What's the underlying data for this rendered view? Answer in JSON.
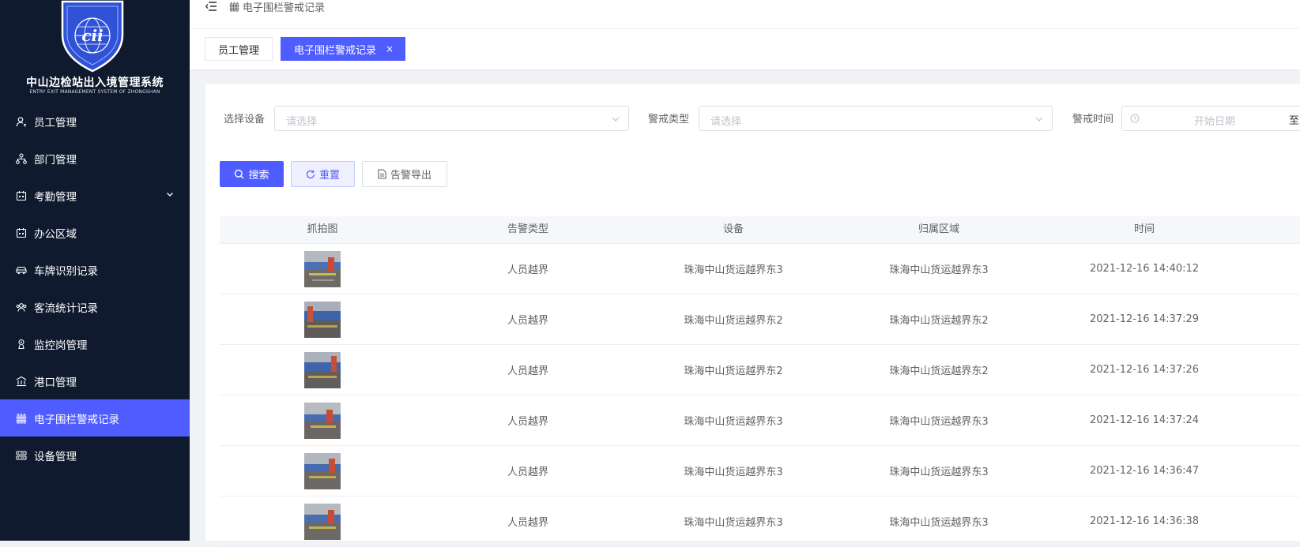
{
  "sidebar": {
    "logo_text": "中国边检",
    "system_title": "中山边检站出入境管理系统",
    "system_subtitle": "ENTRY EXIT MANAGEMENT SYSTEM OF ZHONGSHAN",
    "items": [
      {
        "label": "员工管理",
        "icon": "user-icon"
      },
      {
        "label": "部门管理",
        "icon": "org-chart-icon"
      },
      {
        "label": "考勤管理",
        "icon": "calendar-icon",
        "has_submenu": true
      },
      {
        "label": "办公区域",
        "icon": "calendar-icon"
      },
      {
        "label": "车牌识别记录",
        "icon": "car-icon"
      },
      {
        "label": "客流统计记录",
        "icon": "people-icon"
      },
      {
        "label": "监控岗管理",
        "icon": "monitor-post-icon"
      },
      {
        "label": "港口管理",
        "icon": "building-icon"
      },
      {
        "label": "电子围栏警戒记录",
        "icon": "fence-icon",
        "active": true
      },
      {
        "label": "设备管理",
        "icon": "server-icon"
      }
    ],
    "active_color": "#4f5cff",
    "background_color": "#0f1a2e"
  },
  "header": {
    "breadcrumb": "电子围栏警戒记录"
  },
  "tags": [
    {
      "label": "员工管理",
      "active": false
    },
    {
      "label": "电子围栏警戒记录",
      "active": true,
      "close": "×"
    }
  ],
  "filters": {
    "device_label": "选择设备",
    "device_placeholder": "请选择",
    "type_label": "警戒类型",
    "type_placeholder": "请选择",
    "time_label": "警戒时间",
    "start_placeholder": "开始日期",
    "range_separator": "至"
  },
  "buttons": {
    "search": "搜索",
    "reset": "重置",
    "export": "告警导出"
  },
  "table": {
    "columns": [
      "抓拍图",
      "告警类型",
      "设备",
      "归属区域",
      "时间"
    ],
    "rows": [
      {
        "type": "人员越界",
        "device": "珠海中山货运越界东3",
        "area": "珠海中山货运越界东3",
        "time": "2021-12-16 14:40:12"
      },
      {
        "type": "人员越界",
        "device": "珠海中山货运越界东2",
        "area": "珠海中山货运越界东2",
        "time": "2021-12-16 14:37:29"
      },
      {
        "type": "人员越界",
        "device": "珠海中山货运越界东2",
        "area": "珠海中山货运越界东2",
        "time": "2021-12-16 14:37:26"
      },
      {
        "type": "人员越界",
        "device": "珠海中山货运越界东3",
        "area": "珠海中山货运越界东3",
        "time": "2021-12-16 14:37:24"
      },
      {
        "type": "人员越界",
        "device": "珠海中山货运越界东3",
        "area": "珠海中山货运越界东3",
        "time": "2021-12-16 14:36:47"
      },
      {
        "type": "人员越界",
        "device": "珠海中山货运越界东3",
        "area": "珠海中山货运越界东3",
        "time": "2021-12-16 14:36:38"
      }
    ]
  }
}
